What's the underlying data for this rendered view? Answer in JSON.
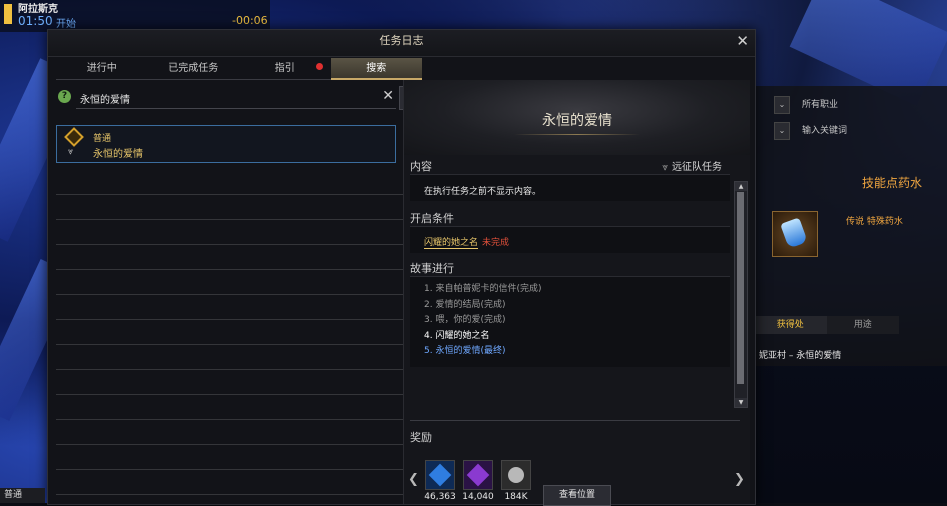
{
  "hud": {
    "zone": "阿拉斯克",
    "time": "01:50",
    "start": "开始",
    "countdown": "-00:06"
  },
  "window": {
    "title": "任务日志",
    "tabs": [
      {
        "label": "进行中"
      },
      {
        "label": "已完成任务"
      },
      {
        "label": "指引"
      },
      {
        "label": "搜索"
      }
    ],
    "active_tab": "搜索"
  },
  "search": {
    "value": "永恒的爱情"
  },
  "results": [
    {
      "type": "普通",
      "name": "永恒的爱情"
    }
  ],
  "detail": {
    "title": "永恒的爱情",
    "content_label": "内容",
    "expedition": "远征队任务",
    "content_text": "在执行任务之前不显示内容。",
    "condition_label": "开启条件",
    "condition_quest": "闪耀的她之名",
    "condition_status": "未完成",
    "story_label": "故事进行",
    "story": [
      "1. 来自帕普妮卡的信件(完成)",
      "2. 爱情的结局(完成)",
      "3. 喂，你的爱(完成)",
      "4. 闪耀的她之名",
      "5. 永恒的爱情(最终)"
    ],
    "reward_label": "奖励",
    "rewards": [
      {
        "value": "46,363",
        "icon": "blue-crystal-icon",
        "color": "#2f7de0"
      },
      {
        "value": "14,040",
        "icon": "purple-crystal-icon",
        "color": "#8a3ad0"
      },
      {
        "value": "184K",
        "icon": "silver-coin-icon",
        "color": "#b8b8b8"
      }
    ],
    "view_location": "查看位置"
  },
  "background_window": {
    "class_filter": "所有职业",
    "keyword_placeholder": "输入关键词",
    "skill_title": "技能点药水",
    "potion_name": "传说 特殊药水",
    "tabs": [
      "获得处",
      "用途"
    ],
    "location": "妮亚村 – 永恒的爱情"
  },
  "bottom_left": "普通",
  "colors": {
    "accent_gold": "#e8c66a",
    "fail_red": "#e0503a",
    "link_blue": "#6fa8ff"
  }
}
